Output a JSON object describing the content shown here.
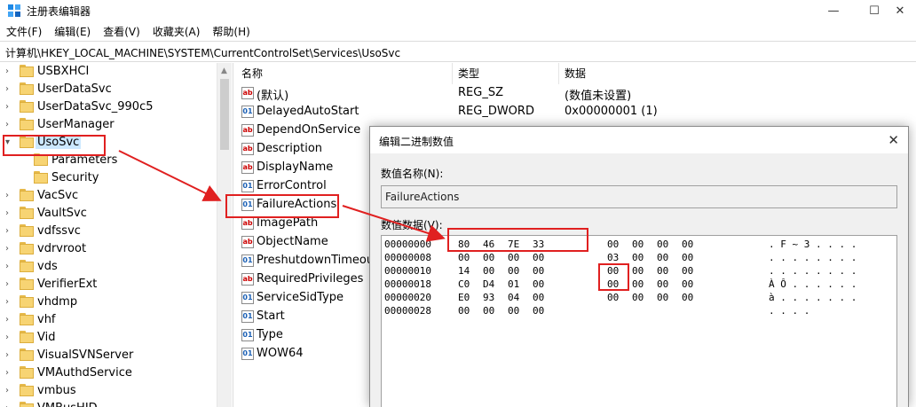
{
  "window": {
    "title": "注册表编辑器",
    "minimize_glyph": "—",
    "maximize_glyph": "☐",
    "close_glyph": "✕"
  },
  "menu": [
    "文件(F)",
    "编辑(E)",
    "查看(V)",
    "收藏夹(A)",
    "帮助(H)"
  ],
  "address": "计算机\\HKEY_LOCAL_MACHINE\\SYSTEM\\CurrentControlSet\\Services\\UsoSvc",
  "tree": [
    {
      "label": "USBXHCI",
      "expander": "collapsed",
      "level": 0
    },
    {
      "label": "UserDataSvc",
      "expander": "collapsed",
      "level": 0
    },
    {
      "label": "UserDataSvc_990c5",
      "expander": "collapsed",
      "level": 0
    },
    {
      "label": "UserManager",
      "expander": "collapsed",
      "level": 0
    },
    {
      "label": "UsoSvc",
      "expander": "expanded",
      "level": 0,
      "selected": true
    },
    {
      "label": "Parameters",
      "expander": "none",
      "level": 1
    },
    {
      "label": "Security",
      "expander": "none",
      "level": 1
    },
    {
      "label": "VacSvc",
      "expander": "collapsed",
      "level": 0
    },
    {
      "label": "VaultSvc",
      "expander": "collapsed",
      "level": 0
    },
    {
      "label": "vdfssvc",
      "expander": "collapsed",
      "level": 0
    },
    {
      "label": "vdrvroot",
      "expander": "collapsed",
      "level": 0
    },
    {
      "label": "vds",
      "expander": "collapsed",
      "level": 0
    },
    {
      "label": "VerifierExt",
      "expander": "collapsed",
      "level": 0
    },
    {
      "label": "vhdmp",
      "expander": "collapsed",
      "level": 0
    },
    {
      "label": "vhf",
      "expander": "collapsed",
      "level": 0
    },
    {
      "label": "Vid",
      "expander": "collapsed",
      "level": 0
    },
    {
      "label": "VisualSVNServer",
      "expander": "collapsed",
      "level": 0
    },
    {
      "label": "VMAuthdService",
      "expander": "collapsed",
      "level": 0
    },
    {
      "label": "vmbus",
      "expander": "collapsed",
      "level": 0
    },
    {
      "label": "VMBusHID",
      "expander": "collapsed",
      "level": 0
    }
  ],
  "list": {
    "headers": {
      "name": "名称",
      "type": "类型",
      "data": "数据"
    },
    "rows": [
      {
        "name": "(默认)",
        "type": "REG_SZ",
        "data": "(数值未设置)",
        "icon": "string-value-icon"
      },
      {
        "name": "DelayedAutoStart",
        "type": "REG_DWORD",
        "data": "0x00000001 (1)",
        "icon": "binary-value-icon"
      },
      {
        "name": "DependOnService",
        "type": "",
        "data": "",
        "icon": "string-value-icon"
      },
      {
        "name": "Description",
        "type": "",
        "data": "",
        "icon": "string-value-icon"
      },
      {
        "name": "DisplayName",
        "type": "",
        "data": "",
        "icon": "string-value-icon"
      },
      {
        "name": "ErrorControl",
        "type": "",
        "data": "",
        "icon": "binary-value-icon"
      },
      {
        "name": "FailureActions",
        "type": "",
        "data": "",
        "icon": "binary-value-icon"
      },
      {
        "name": "ImagePath",
        "type": "",
        "data": "",
        "icon": "string-value-icon"
      },
      {
        "name": "ObjectName",
        "type": "",
        "data": "",
        "icon": "string-value-icon"
      },
      {
        "name": "PreshutdownTimeout",
        "type": "",
        "data": "",
        "icon": "binary-value-icon"
      },
      {
        "name": "RequiredPrivileges",
        "type": "",
        "data": "",
        "icon": "string-value-icon"
      },
      {
        "name": "ServiceSidType",
        "type": "",
        "data": "",
        "icon": "binary-value-icon"
      },
      {
        "name": "Start",
        "type": "",
        "data": "",
        "icon": "binary-value-icon"
      },
      {
        "name": "Type",
        "type": "",
        "data": "",
        "icon": "binary-value-icon"
      },
      {
        "name": "WOW64",
        "type": "",
        "data": "",
        "icon": "binary-value-icon"
      }
    ]
  },
  "dialog": {
    "title": "编辑二进制数值",
    "close_glyph": "✕",
    "name_label": "数值名称(N):",
    "name_value": "FailureActions",
    "data_label": "数值数据(V):",
    "hex_rows": [
      {
        "addr": "00000000",
        "bytes": [
          "80",
          "46",
          "7E",
          "33",
          "00",
          "00",
          "00",
          "00"
        ],
        "ascii": ". F ~ 3 . . . ."
      },
      {
        "addr": "00000008",
        "bytes": [
          "00",
          "00",
          "00",
          "00",
          "03",
          "00",
          "00",
          "00"
        ],
        "ascii": ". . . . . . . ."
      },
      {
        "addr": "00000010",
        "bytes": [
          "14",
          "00",
          "00",
          "00",
          "00",
          "00",
          "00",
          "00"
        ],
        "ascii": ". . . . . . . ."
      },
      {
        "addr": "00000018",
        "bytes": [
          "C0",
          "D4",
          "01",
          "00",
          "00",
          "00",
          "00",
          "00"
        ],
        "ascii": "À Ô . . . . . ."
      },
      {
        "addr": "00000020",
        "bytes": [
          "E0",
          "93",
          "04",
          "00",
          "00",
          "00",
          "00",
          "00"
        ],
        "ascii": "à . . . . . . ."
      },
      {
        "addr": "00000028",
        "bytes": [
          "00",
          "00",
          "00",
          "00"
        ],
        "ascii": ". . . ."
      }
    ]
  },
  "colors": {
    "selection": "#cce8ff",
    "annotation_red": "#e02020",
    "folder": "#f7d473"
  }
}
